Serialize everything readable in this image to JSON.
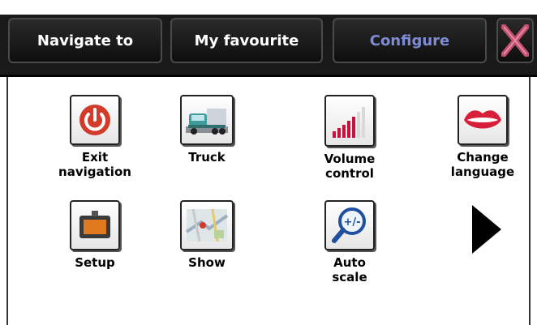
{
  "tabs": [
    {
      "label": "Navigate to"
    },
    {
      "label": "My favourite"
    },
    {
      "label": "Configure",
      "active": true
    }
  ],
  "items": [
    {
      "label": "Exit\nnavigation",
      "icon": "power-icon"
    },
    {
      "label": "Truck",
      "icon": "truck-icon"
    },
    {
      "label": "Volume\ncontrol",
      "icon": "volume-bars-icon"
    },
    {
      "label": "Change\nlanguage",
      "icon": "lips-icon"
    },
    {
      "label": "Setup",
      "icon": "gps-device-icon"
    },
    {
      "label": "Show",
      "icon": "map-icon"
    },
    {
      "label": "Auto\nscale",
      "icon": "magnifier-zoom-icon"
    }
  ],
  "colors": {
    "topbar": "#1a1a1a",
    "active_tab_text": "#7e8bd6",
    "close_x": "#c0506e",
    "power_red": "#d23a2a",
    "volume_bar": "#c8103c"
  }
}
